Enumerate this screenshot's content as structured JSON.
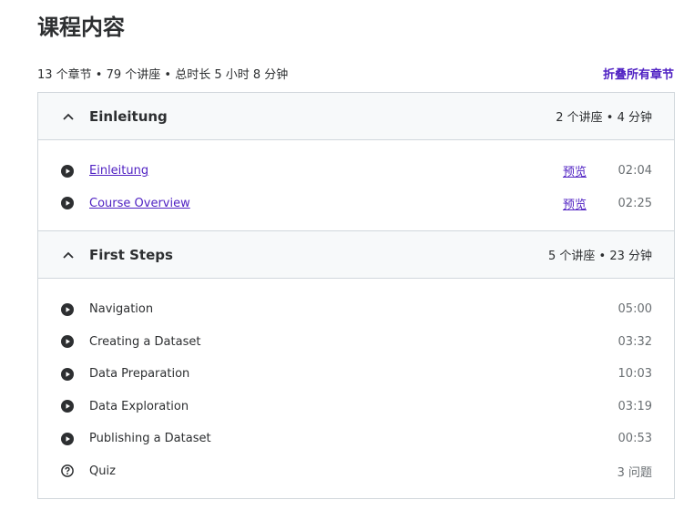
{
  "page": {
    "title": "课程内容",
    "summary": "13 个章节 • 79 个讲座 • 总时长 5 小时 8 分钟",
    "collapse_all_label": "折叠所有章节"
  },
  "sections": [
    {
      "title": "Einleitung",
      "meta": "2 个讲座 • 4 分钟",
      "lectures": [
        {
          "title": "Einleitung",
          "preview": "预览",
          "duration": "02:04"
        },
        {
          "title": "Course Overview",
          "preview": "预览",
          "duration": "02:25"
        }
      ]
    },
    {
      "title": "First Steps",
      "meta": "5 个讲座 • 23 分钟",
      "lectures": [
        {
          "title": "Navigation",
          "duration": "05:00"
        },
        {
          "title": "Creating a Dataset",
          "duration": "03:32"
        },
        {
          "title": "Data Preparation",
          "duration": "10:03"
        },
        {
          "title": "Data Exploration",
          "duration": "03:19"
        },
        {
          "title": "Publishing a Dataset",
          "duration": "00:53"
        },
        {
          "title": "Quiz",
          "duration": "3 问题"
        }
      ]
    }
  ],
  "icons": {
    "chevron": "chevron-up-icon",
    "video": "play-circle-icon",
    "quiz": "question-circle-icon"
  },
  "colors": {
    "link": "#5022c3",
    "text": "#2d2f31",
    "muted": "#6a6f73",
    "border": "#d1d7dc",
    "header_bg": "#f7f9fa"
  }
}
